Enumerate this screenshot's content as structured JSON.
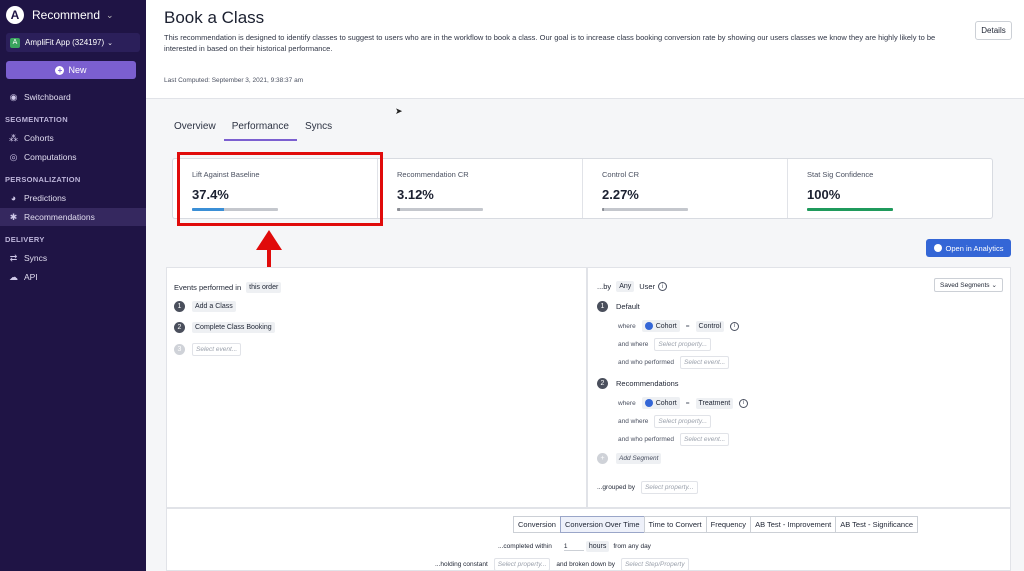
{
  "sidebar": {
    "app_name": "Recommend",
    "project": "AmpliFit App (324197)",
    "project_badge": "A",
    "new_label": "New",
    "switchboard": "Switchboard",
    "sections": {
      "segmentation": "SEGMENTATION",
      "personalization": "PERSONALIZATION",
      "delivery": "DELIVERY"
    },
    "items": {
      "cohorts": "Cohorts",
      "computations": "Computations",
      "predictions": "Predictions",
      "recommendations": "Recommendations",
      "syncs": "Syncs",
      "api": "API"
    }
  },
  "header": {
    "title": "Book a Class",
    "description": "This recommendation is designed to identify classes to suggest to users who are in the workflow to book a class. Our goal is to increase class booking conversion rate by showing our users classes we know they are highly likely to be interested in based on their historical performance.",
    "details_label": "Details",
    "last_computed": "Last Computed: September 3, 2021, 9:38:37 am"
  },
  "tabs": [
    "Overview",
    "Performance",
    "Syncs"
  ],
  "active_tab": "Performance",
  "metrics": [
    {
      "label": "Lift Against Baseline",
      "value": "37.4%",
      "bar_fraction": 0.374,
      "color": "#3b8fd6"
    },
    {
      "label": "Recommendation CR",
      "value": "3.12%",
      "bar_fraction": 0.0312,
      "color": "#8c8f96"
    },
    {
      "label": "Control CR",
      "value": "2.27%",
      "bar_fraction": 0.0227,
      "color": "#8c8f96"
    },
    {
      "label": "Stat Sig Confidence",
      "value": "100%",
      "bar_fraction": 1.0,
      "color": "#1f9a5c"
    }
  ],
  "open_analytics": "Open in Analytics",
  "events": {
    "heading": "Events performed in",
    "order_label": "this order",
    "list": [
      {
        "n": "1",
        "name": "Add a Class"
      },
      {
        "n": "2",
        "name": "Complete Class Booking"
      }
    ],
    "select_n": "3",
    "select_placeholder": "Select event..."
  },
  "segments": {
    "by_label": "...by",
    "any_label": "Any",
    "user_label": "User",
    "saved_label": "Saved Segments",
    "items": [
      {
        "n": "1",
        "name": "Default",
        "where": "where",
        "prop": "Cohort",
        "op": "=",
        "value": "Control",
        "and_where": "and where",
        "prop_ph": "Select property...",
        "and_performed": "and who performed",
        "event_ph": "Select event..."
      },
      {
        "n": "2",
        "name": "Recommendations",
        "where": "where",
        "prop": "Cohort",
        "op": "=",
        "value": "Treatment",
        "and_where": "and where",
        "prop_ph": "Select property...",
        "and_performed": "and who performed",
        "event_ph": "Select event..."
      }
    ],
    "add_segment": "Add Segment",
    "grouped_by": "...grouped by",
    "grouped_ph": "Select property..."
  },
  "bottom": {
    "tabs": [
      "Conversion",
      "Conversion Over Time",
      "Time to Convert",
      "Frequency",
      "AB Test - Improvement",
      "AB Test - Significance"
    ],
    "active_tab": "Conversion Over Time",
    "completed_within": "...completed within",
    "within_value": "1",
    "unit": "hours",
    "from_any_day": "from any day",
    "holding": "...holding constant",
    "holding_ph": "Select property...",
    "broken_down": "and broken down by",
    "broken_ph": "Select Step/Property"
  }
}
